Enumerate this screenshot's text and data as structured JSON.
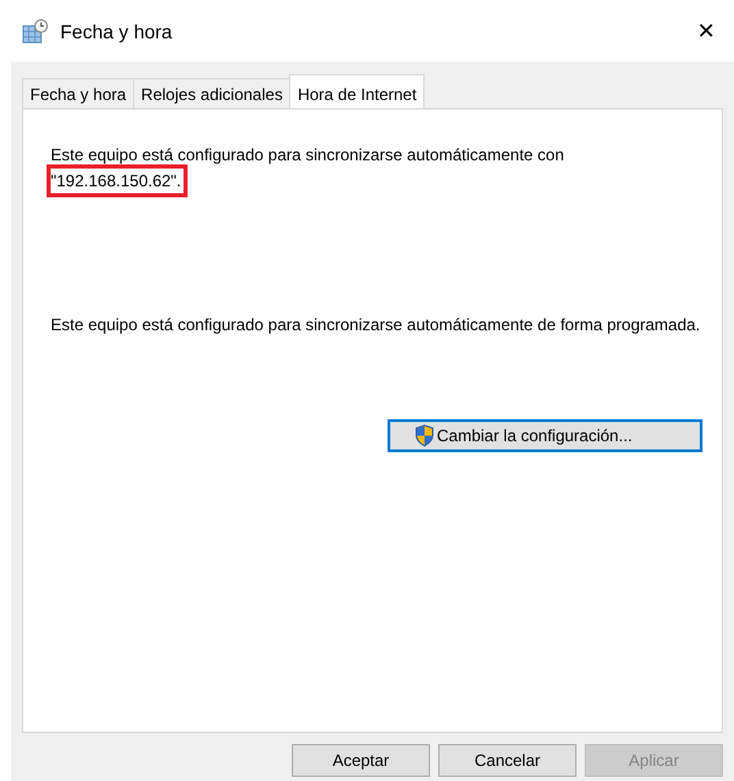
{
  "window": {
    "title": "Fecha y hora",
    "close": "✕"
  },
  "tabs": [
    {
      "label": "Fecha y hora",
      "selected": false
    },
    {
      "label": "Relojes adicionales",
      "selected": false
    },
    {
      "label": "Hora de Internet",
      "selected": true
    }
  ],
  "sync_server": {
    "text": "Este equipo está configurado para sincronizarse automáticamente con",
    "server": "\"192.168.150.62\".",
    "highlighted": true
  },
  "schedule_text": "Este equipo está configurado para sincronizarse automáticamente de forma programada.",
  "change_button": {
    "label": "Cambiar la configuración..."
  },
  "buttons": [
    {
      "label": "Aceptar",
      "disabled": false
    },
    {
      "label": "Cancelar",
      "disabled": false
    },
    {
      "label": "Aplicar",
      "disabled": true
    }
  ]
}
